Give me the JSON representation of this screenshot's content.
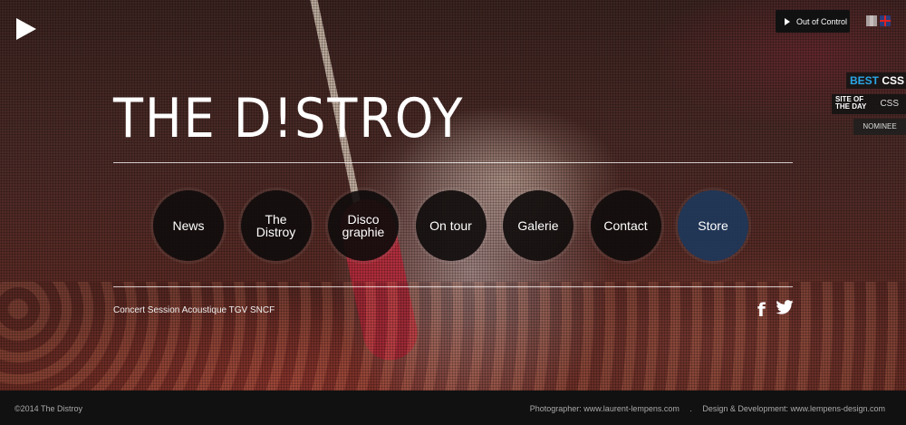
{
  "header": {
    "now_playing": "Out of Control",
    "languages": [
      "fr",
      "en"
    ],
    "awards": {
      "best_part1": "BEST",
      "best_part2": "CSS",
      "sotd_line1": "SITE OF",
      "sotd_line2": "THE DAY",
      "sotd_css": "CSS",
      "nominee": "NOMINEE"
    }
  },
  "brand": {
    "logo_text": "THE D!STROY"
  },
  "nav": {
    "items": [
      {
        "label": "News"
      },
      {
        "label": "The\nDistroy"
      },
      {
        "label": "Disco\ngraphie"
      },
      {
        "label": "On tour"
      },
      {
        "label": "Galerie"
      },
      {
        "label": "Contact"
      },
      {
        "label": "Store"
      }
    ]
  },
  "caption": "Concert Session Acoustique TGV SNCF",
  "social": {
    "facebook": "f"
  },
  "footer": {
    "copyright": "©2014 The Distroy",
    "photographer": "Photographer: www.laurent-lempens.com",
    "separator": ".",
    "design": "Design & Development: www.lempens-design.com"
  },
  "colors": {
    "store_accent": "#1e375a",
    "twitter": "#ffffff",
    "best_css_blue": "#2aa7e6"
  },
  "icons": [
    "play-icon",
    "facebook-icon",
    "twitter-icon",
    "flag-fr-icon",
    "flag-uk-icon"
  ]
}
